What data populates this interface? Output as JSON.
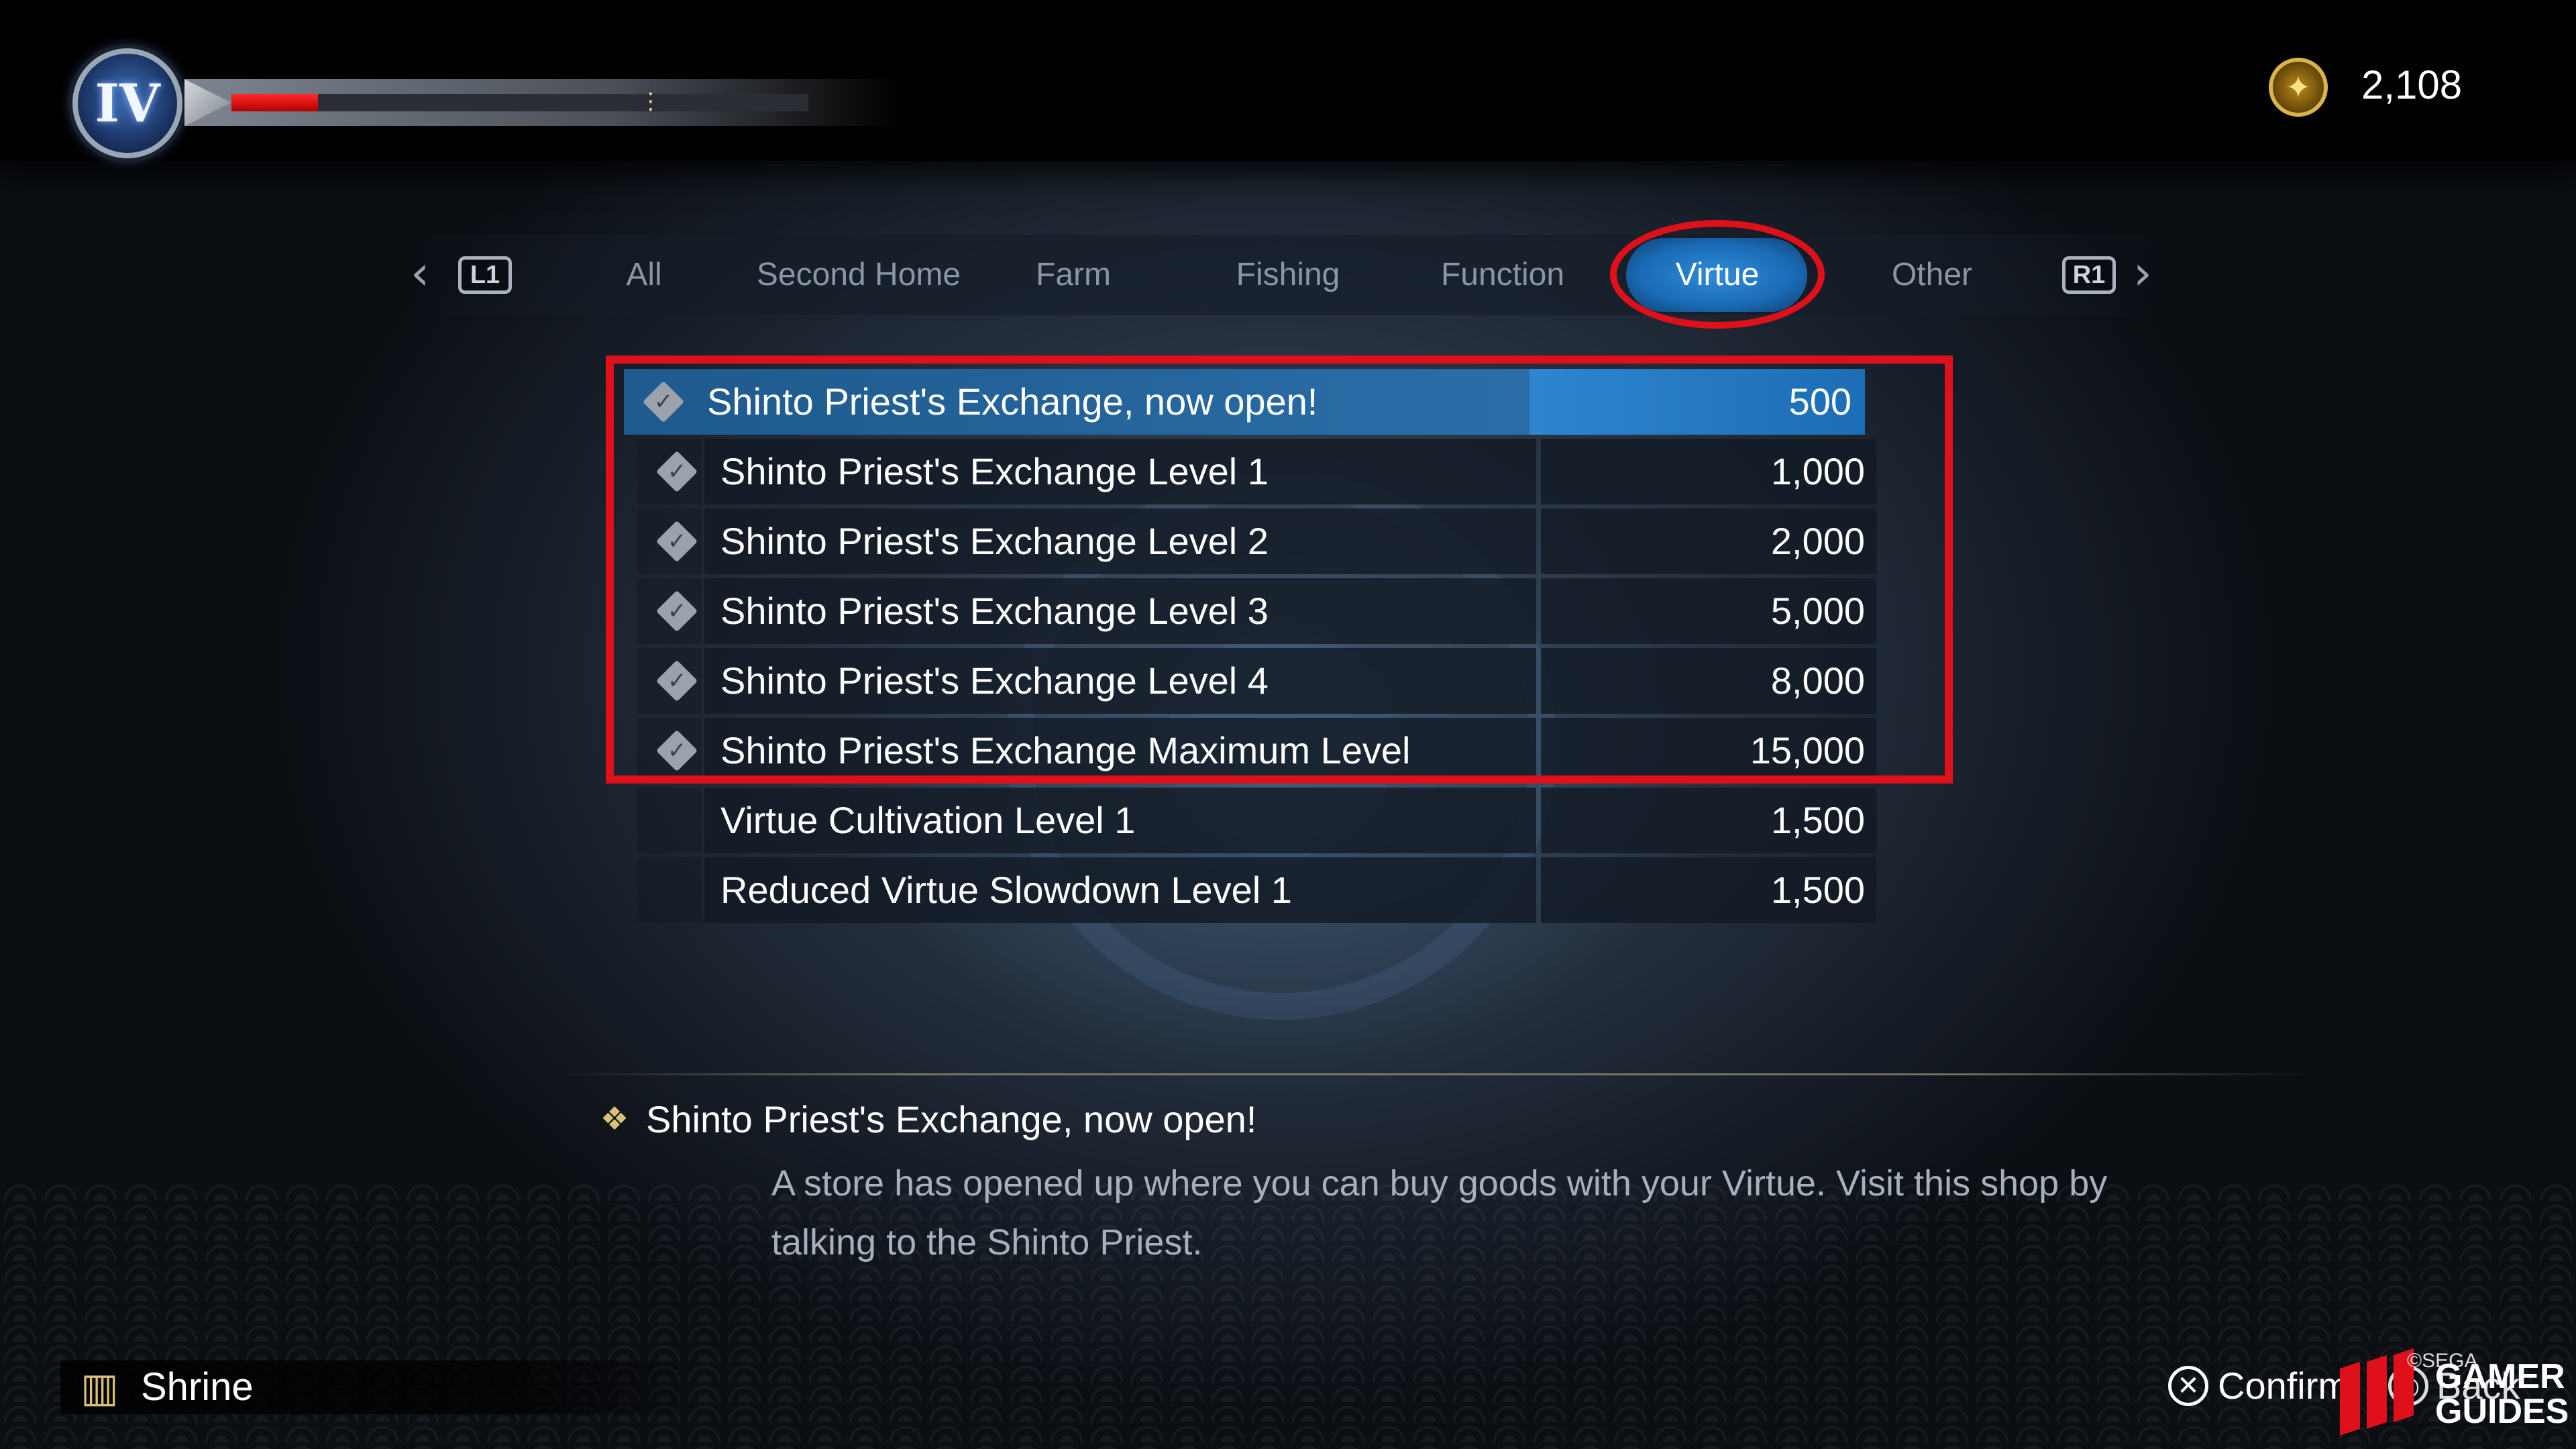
{
  "hud": {
    "rank": "IV",
    "health_fraction": 0.15,
    "currency_icon": "virtue-coin-icon",
    "currency_value": "2,108"
  },
  "tabs": {
    "left_button": "L1",
    "right_button": "R1",
    "items": [
      {
        "label": "All"
      },
      {
        "label": "Second Home"
      },
      {
        "label": "Farm"
      },
      {
        "label": "Fishing"
      },
      {
        "label": "Function"
      },
      {
        "label": "Virtue"
      },
      {
        "label": "Other"
      }
    ],
    "active": "Virtue"
  },
  "list": {
    "items": [
      {
        "label": "Shinto Priest's Exchange, now open!",
        "value": "500",
        "checked": true,
        "selected": true
      },
      {
        "label": "Shinto Priest's Exchange Level 1",
        "value": "1,000",
        "checked": true,
        "selected": false
      },
      {
        "label": "Shinto Priest's Exchange Level 2",
        "value": "2,000",
        "checked": true,
        "selected": false
      },
      {
        "label": "Shinto Priest's Exchange Level 3",
        "value": "5,000",
        "checked": true,
        "selected": false
      },
      {
        "label": "Shinto Priest's Exchange Level 4",
        "value": "8,000",
        "checked": true,
        "selected": false
      },
      {
        "label": "Shinto Priest's Exchange Maximum Level",
        "value": "15,000",
        "checked": true,
        "selected": false
      },
      {
        "label": "Virtue Cultivation Level 1",
        "value": "1,500",
        "checked": false,
        "selected": false
      },
      {
        "label": "Reduced Virtue Slowdown Level 1",
        "value": "1,500",
        "checked": false,
        "selected": false
      }
    ]
  },
  "description": {
    "title": "Shinto Priest's Exchange, now open!",
    "line1": "A store has opened up where you can buy goods with your Virtue. Visit this shop by",
    "line2": "talking to the Shinto Priest."
  },
  "footer": {
    "location": "Shrine",
    "confirm_label": "Confirm",
    "back_label": "Back"
  },
  "watermark": {
    "copyright": "©SEGA",
    "brand_line1": "GAMER",
    "brand_line2": "GUIDES"
  },
  "colors": {
    "accent_blue": "#2e86cf",
    "highlight_red": "#e0101a",
    "health_red": "#e01010",
    "gold": "#d9b44a"
  }
}
